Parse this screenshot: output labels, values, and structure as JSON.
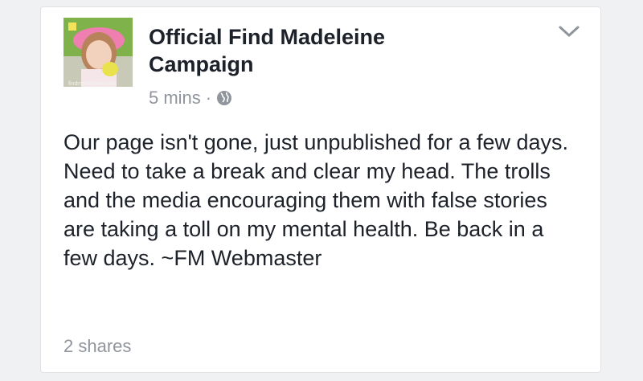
{
  "post": {
    "page_name": "Official Find Madeleine Campaign",
    "avatar_watermark": "findmadeleine.com",
    "timestamp": "5 mins",
    "separator": "·",
    "audience_icon": "globe-icon",
    "menu_icon": "chevron-down-icon",
    "text": "Our page isn't gone, just unpublished for a few days. Need to take a break and clear my head. The trolls and the media encouraging them with false stories are taking a toll on my mental health. Be back in a few days. ~FM Webmaster",
    "shares": "2 shares"
  },
  "colors": {
    "primary_text": "#1d2129",
    "secondary_text": "#90949c",
    "card_bg": "#ffffff",
    "page_bg": "#f0f1f3"
  }
}
